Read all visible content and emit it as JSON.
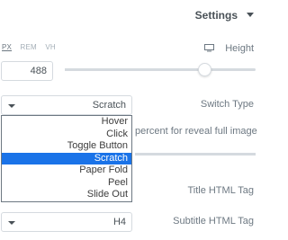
{
  "header": {
    "title": "Settings"
  },
  "units": {
    "px": "PX",
    "rem": "REM",
    "vh": "VH",
    "active": "PX"
  },
  "height": {
    "label": "Height",
    "value": "488",
    "slider_fraction": 0.73
  },
  "switch_type": {
    "label": "Switch Type",
    "selected": "Scratch",
    "options": [
      "Hover",
      "Click",
      "Toggle Button",
      "Scratch",
      "Paper Fold",
      "Peel",
      "Slide Out"
    ]
  },
  "percent": {
    "label": "percent for reveal full image"
  },
  "title_tag": {
    "label": "Title HTML Tag"
  },
  "subtitle_tag": {
    "label": "Subtitle HTML Tag",
    "value": "H4"
  },
  "colors": {
    "selected_option": "#1a73e8",
    "border": "#d5dadf",
    "text": "#6d7882"
  },
  "icons": [
    "monitor-icon",
    "caret-down-icon"
  ]
}
